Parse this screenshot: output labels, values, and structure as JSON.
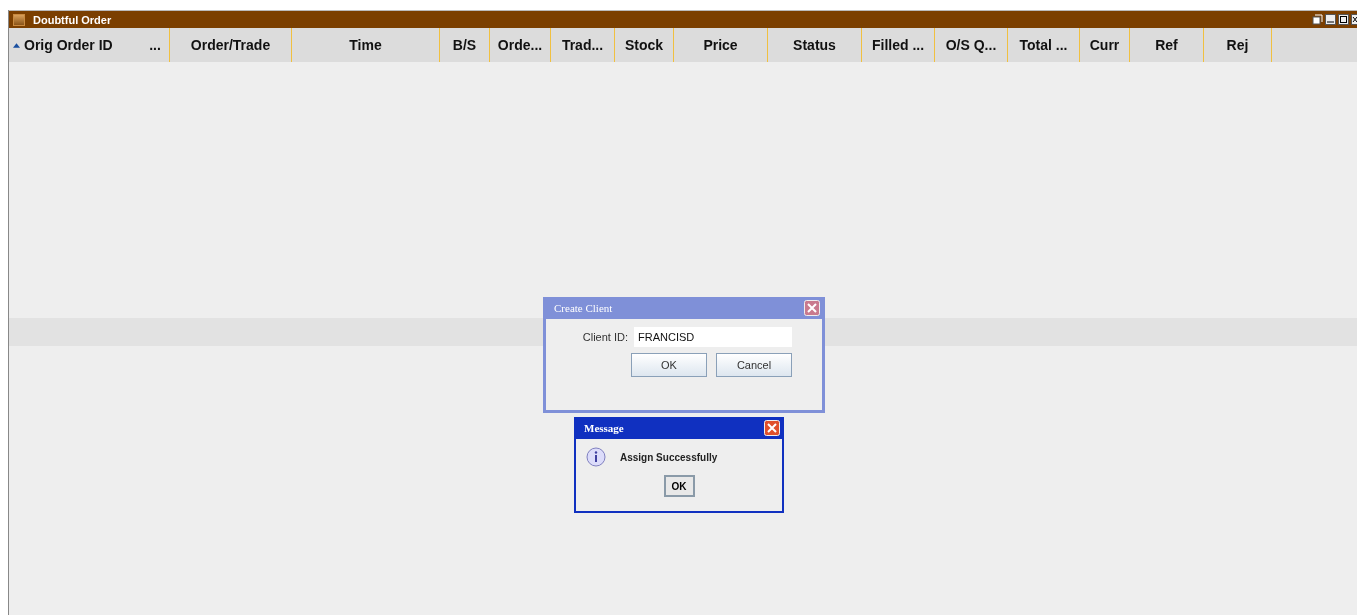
{
  "window": {
    "title": "Doubtful Order"
  },
  "table": {
    "columns": [
      {
        "label": "Orig Order ID",
        "sorted": true
      },
      {
        "label": "...",
        "sorted": false
      },
      {
        "label": "Order/Trade",
        "sorted": false
      },
      {
        "label": "Time",
        "sorted": false
      },
      {
        "label": "B/S",
        "sorted": false
      },
      {
        "label": "Orde...",
        "sorted": false
      },
      {
        "label": "Trad...",
        "sorted": false
      },
      {
        "label": "Stock",
        "sorted": false
      },
      {
        "label": "Price",
        "sorted": false
      },
      {
        "label": "Status",
        "sorted": false
      },
      {
        "label": "Filled ...",
        "sorted": false
      },
      {
        "label": "O/S Q...",
        "sorted": false
      },
      {
        "label": "Total ...",
        "sorted": false
      },
      {
        "label": "Curr",
        "sorted": false
      },
      {
        "label": "Ref",
        "sorted": false
      },
      {
        "label": "Rej",
        "sorted": false
      }
    ]
  },
  "create_client_dialog": {
    "title": "Create Client",
    "field_label": "Client ID:",
    "field_value": "FRANCISD",
    "buttons": [
      "OK",
      "Cancel"
    ]
  },
  "message_dialog": {
    "title": "Message",
    "message": "Assign Successfully",
    "buttons": [
      "OK"
    ]
  }
}
